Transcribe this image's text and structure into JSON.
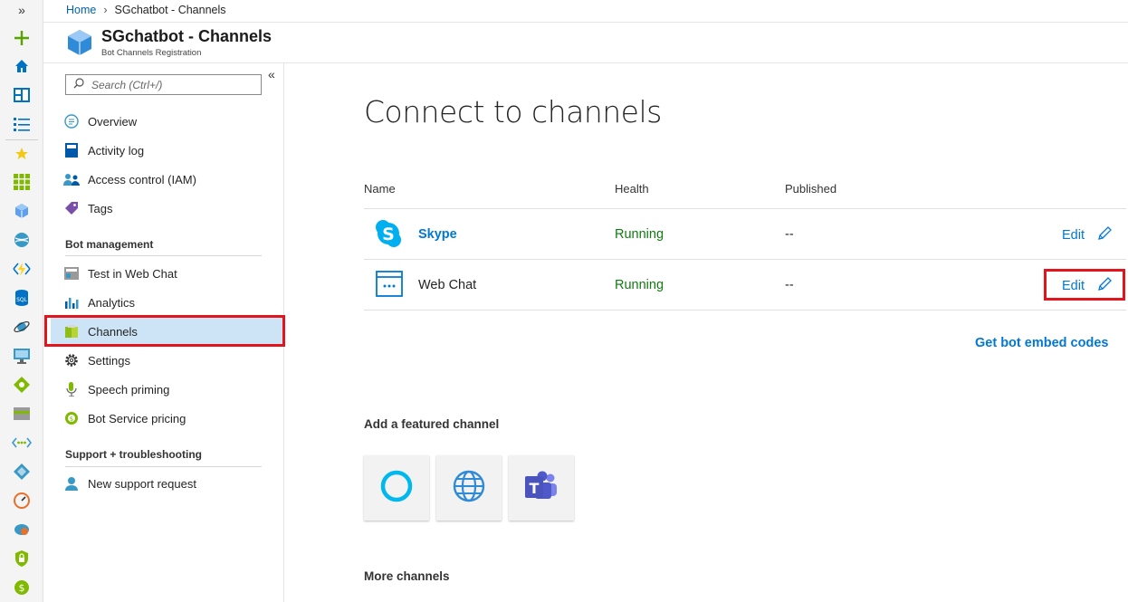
{
  "rail": {
    "expand": "»",
    "icons": [
      "create-resource-icon",
      "home-icon",
      "dashboard-icon",
      "all-services-icon",
      "favorites-star-icon",
      "all-resources-icon",
      "resource-groups-icon",
      "app-services-icon",
      "function-apps-icon",
      "sql-databases-icon",
      "cosmos-db-icon",
      "virtual-machines-icon",
      "load-balancers-icon",
      "storage-accounts-icon",
      "virtual-networks-icon",
      "azure-ad-icon",
      "monitor-icon",
      "advisor-icon",
      "security-center-icon",
      "cost-management-icon"
    ]
  },
  "breadcrumb": {
    "home": "Home",
    "current": "SGchatbot - Channels"
  },
  "resource": {
    "title": "SGchatbot - Channels",
    "subtitle": "Bot Channels Registration"
  },
  "blade": {
    "collapse": "«",
    "search_placeholder": "Search (Ctrl+/)",
    "items": [
      {
        "label": "Overview",
        "icon": "overview-icon"
      },
      {
        "label": "Activity log",
        "icon": "activity-log-icon"
      },
      {
        "label": "Access control (IAM)",
        "icon": "iam-icon"
      },
      {
        "label": "Tags",
        "icon": "tag-icon"
      }
    ],
    "section_bot": "Bot management",
    "bot_items": [
      {
        "label": "Test in Web Chat",
        "icon": "test-webchat-icon"
      },
      {
        "label": "Analytics",
        "icon": "analytics-icon"
      },
      {
        "label": "Channels",
        "icon": "channels-icon",
        "selected": true
      },
      {
        "label": "Settings",
        "icon": "settings-gear-icon"
      },
      {
        "label": "Speech priming",
        "icon": "microphone-icon"
      },
      {
        "label": "Bot Service pricing",
        "icon": "pricing-icon"
      }
    ],
    "section_support": "Support + troubleshooting",
    "support_items": [
      {
        "label": "New support request",
        "icon": "support-person-icon"
      }
    ]
  },
  "main": {
    "title": "Connect to channels",
    "columns": {
      "name": "Name",
      "health": "Health",
      "published": "Published"
    },
    "rows": [
      {
        "name": "Skype",
        "health": "Running",
        "published": "--",
        "edit": "Edit",
        "icon": "skype-icon"
      },
      {
        "name": "Web Chat",
        "health": "Running",
        "published": "--",
        "edit": "Edit",
        "icon": "webchat-window-icon"
      }
    ],
    "embed_link": "Get bot embed codes",
    "featured_heading": "Add a featured channel",
    "featured": [
      "cortana-icon",
      "direct-line-globe-icon",
      "microsoft-teams-icon"
    ],
    "more_heading": "More channels"
  },
  "colors": {
    "accent": "#0078d4",
    "running": "#107c10",
    "highlight": "#e3141b",
    "selected_bg": "#cce4f6"
  }
}
